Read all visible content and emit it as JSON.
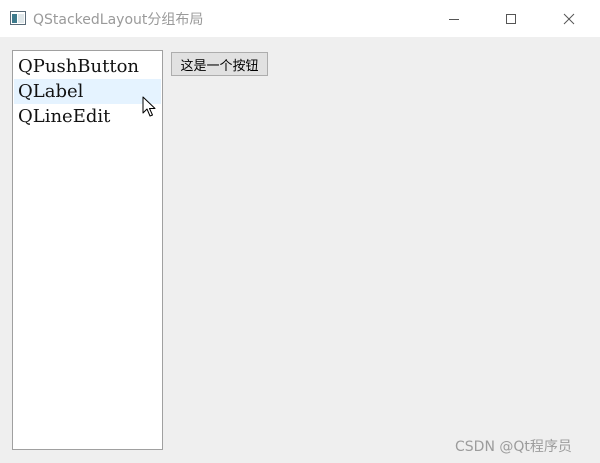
{
  "window": {
    "title": "QStackedLayout分组布局",
    "controls": {
      "minimize_icon": "minimize-icon",
      "maximize_icon": "maximize-icon",
      "close_icon": "close-icon"
    }
  },
  "list": {
    "items": [
      {
        "label": "QPushButton"
      },
      {
        "label": "QLabel"
      },
      {
        "label": "QLineEdit"
      }
    ],
    "hovered_index": 1
  },
  "stack_page": {
    "button_label": "这是一个按钮"
  },
  "watermark": "CSDN @Qt程序员",
  "colors": {
    "hover_bg": "#e5f3ff",
    "title_text": "#9a9a9a",
    "client_bg": "#efefef"
  }
}
